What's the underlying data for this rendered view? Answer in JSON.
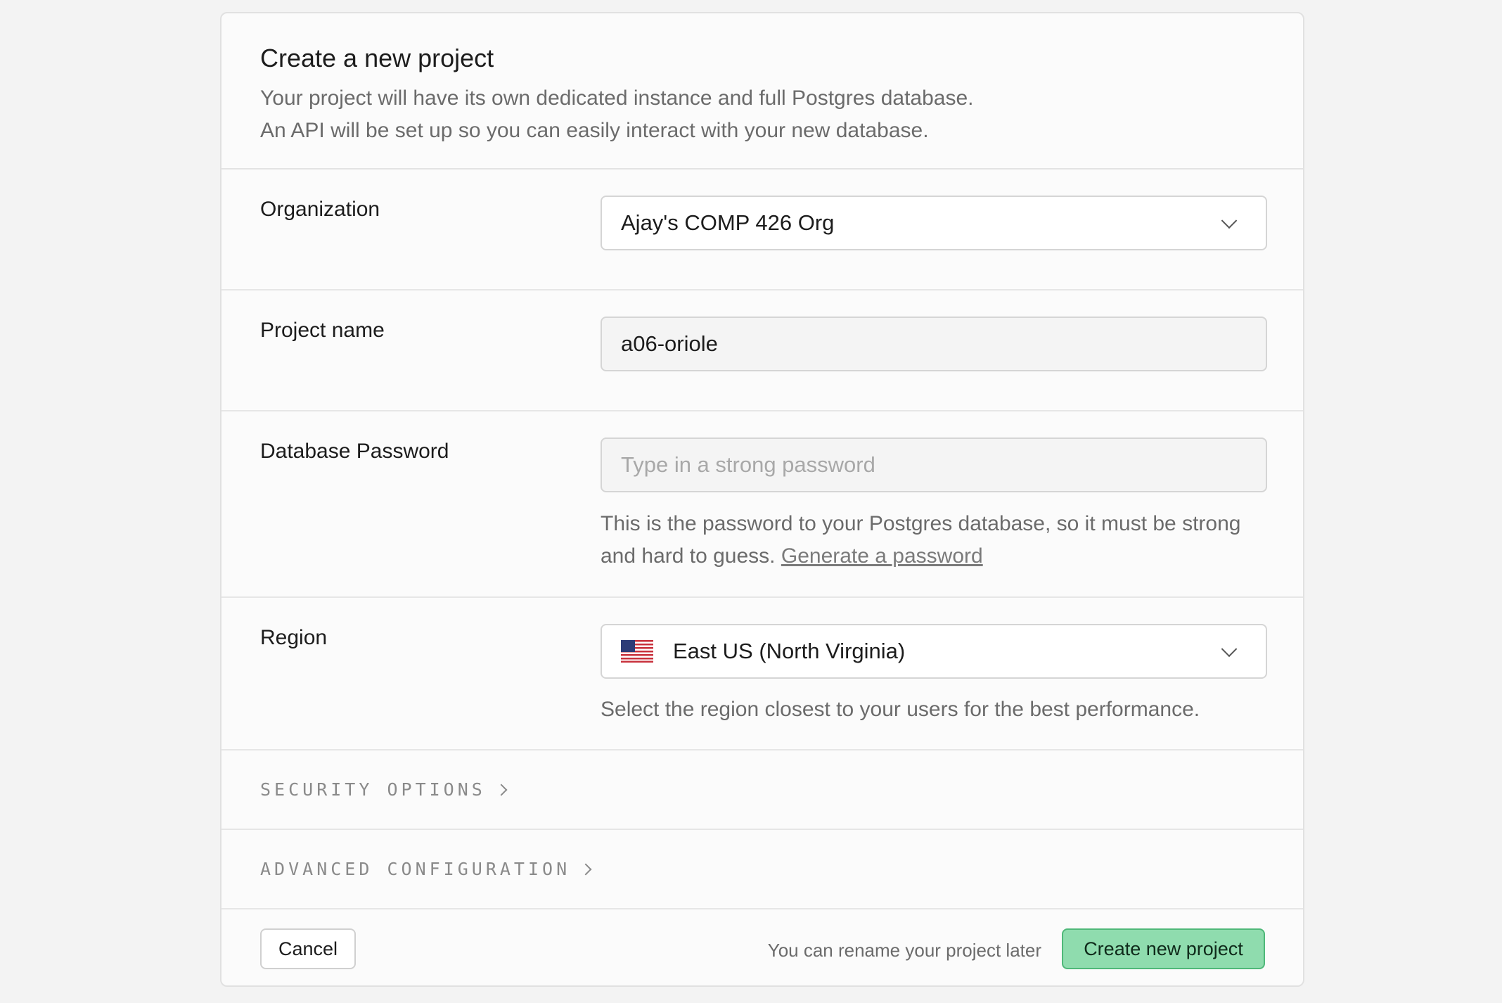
{
  "header": {
    "title": "Create a new project",
    "description_line1": "Your project will have its own dedicated instance and full Postgres database.",
    "description_line2": "An API will be set up so you can easily interact with your new database."
  },
  "organization": {
    "label": "Organization",
    "selected": "Ajay's COMP 426 Org",
    "icon": "chevron-down-icon"
  },
  "project_name": {
    "label": "Project name",
    "value": "a06-oriole"
  },
  "database_password": {
    "label": "Database Password",
    "placeholder": "Type in a strong password",
    "value": "",
    "help_text": "This is the password to your Postgres database, so it must be strong and hard to guess.",
    "generate_link": "Generate a password"
  },
  "region": {
    "label": "Region",
    "selected": "East US (North Virginia)",
    "flag_icon": "us-flag-icon",
    "help_text": "Select the region closest to your users for the best performance."
  },
  "sections": {
    "security_options": "SECURITY OPTIONS",
    "advanced_configuration": "ADVANCED CONFIGURATION"
  },
  "footer": {
    "cancel_label": "Cancel",
    "rename_note": "You can rename your project later",
    "create_label": "Create new project"
  },
  "colors": {
    "create_button_bg": "#8fdcae",
    "create_button_border": "#4fb879",
    "page_bg": "#f3f3f3",
    "card_bg": "#fbfbfb"
  }
}
